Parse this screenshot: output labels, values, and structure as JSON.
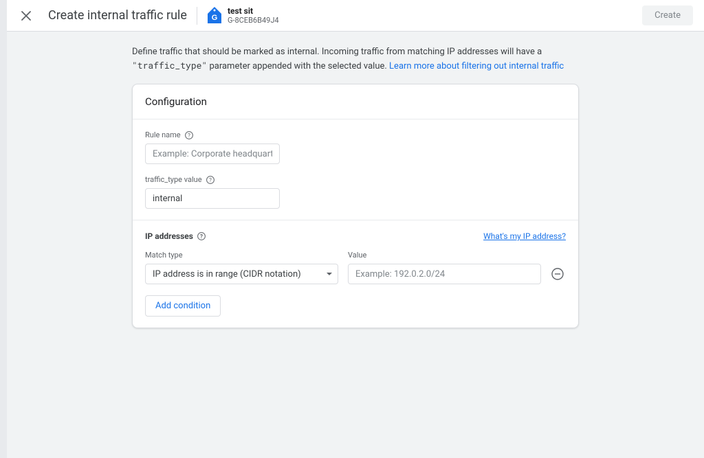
{
  "header": {
    "title": "Create internal traffic rule",
    "property_name": "test sit",
    "property_id": "G-8CEB6B49J4",
    "create_button": "Create"
  },
  "description": {
    "text_before": "Define traffic that should be marked as internal. Incoming traffic from matching IP addresses will have a ",
    "code": "\"traffic_type\"",
    "text_after": " parameter appended with the selected value. ",
    "link_text": "Learn more about filtering out internal traffic"
  },
  "config": {
    "title": "Configuration",
    "rule_name_label": "Rule name",
    "rule_name_placeholder": "Example: Corporate headquarters",
    "rule_name_value": "",
    "traffic_type_label": "traffic_type value",
    "traffic_type_value": "internal",
    "ip_section_label": "IP addresses",
    "whats_my_ip": "What's my IP address?",
    "match_type_label": "Match type",
    "match_type_value": "IP address is in range (CIDR notation)",
    "value_label": "Value",
    "value_placeholder": "Example: 192.0.2.0/24",
    "value_value": "",
    "add_condition": "Add condition"
  }
}
